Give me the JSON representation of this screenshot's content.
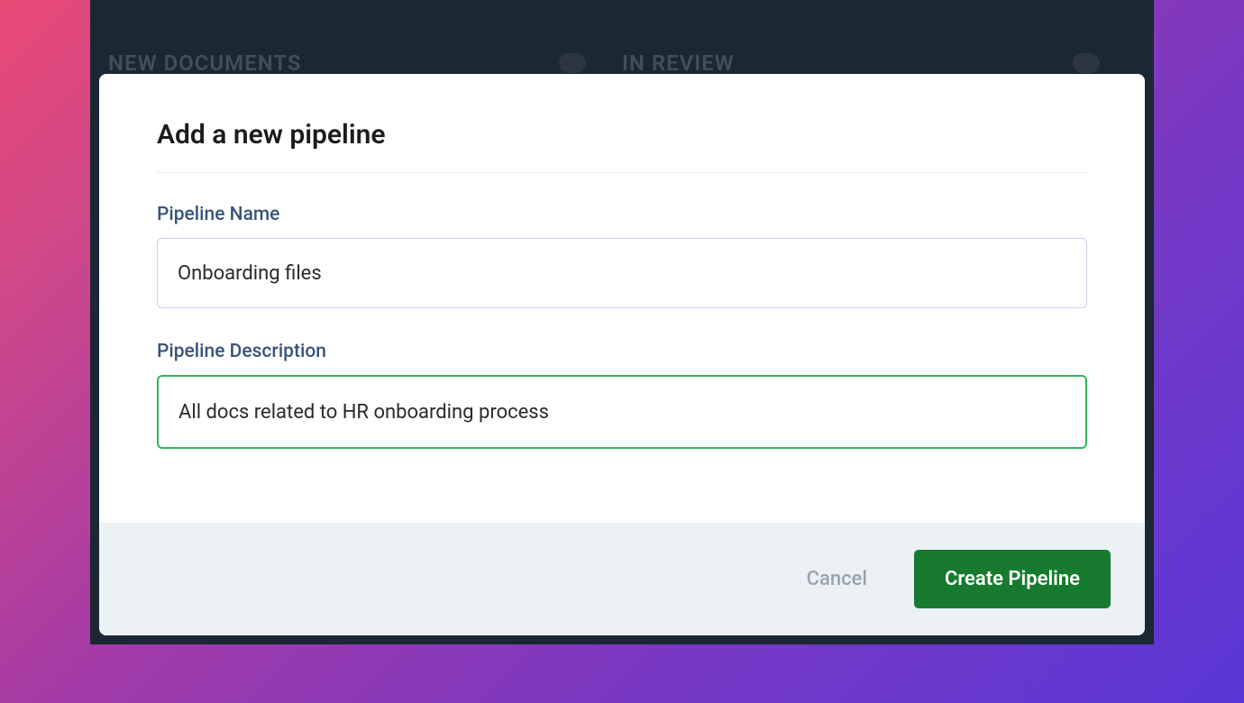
{
  "background": {
    "columns": [
      {
        "label": "NEW DOCUMENTS"
      },
      {
        "label": "IN REVIEW"
      }
    ]
  },
  "modal": {
    "title": "Add a new pipeline",
    "fields": {
      "name": {
        "label": "Pipeline Name",
        "value": "Onboarding files"
      },
      "description": {
        "label": "Pipeline Description",
        "value": "All docs related to HR onboarding process"
      }
    },
    "buttons": {
      "cancel": "Cancel",
      "submit": "Create Pipeline"
    }
  }
}
